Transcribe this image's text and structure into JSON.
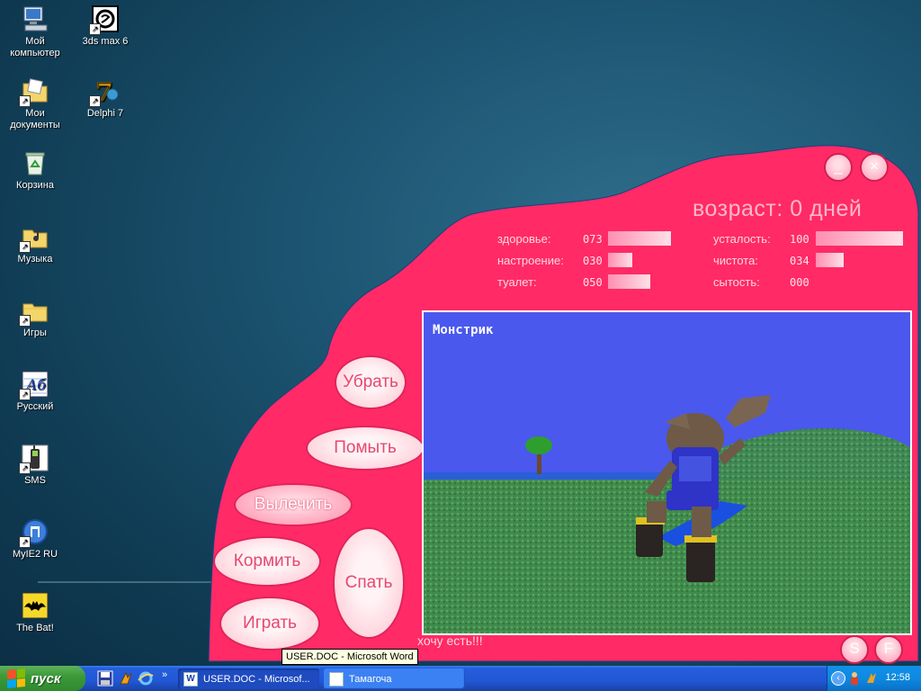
{
  "desktop": {
    "icons": [
      {
        "label": "Мой компьютер",
        "icon": "my-computer-icon"
      },
      {
        "label": "3ds max 6",
        "icon": "3dsmax-icon"
      },
      {
        "label": "Мои документы",
        "icon": "my-documents-icon"
      },
      {
        "label": "Delphi 7",
        "icon": "delphi-icon"
      },
      {
        "label": "Корзина",
        "icon": "recycle-bin-icon"
      },
      {
        "label": "Музыка",
        "icon": "music-folder-icon"
      },
      {
        "label": "Игры",
        "icon": "games-folder-icon"
      },
      {
        "label": "Русский",
        "icon": "russian-icon"
      },
      {
        "label": "SMS",
        "icon": "sms-icon"
      },
      {
        "label": "MyIE2 RU",
        "icon": "myie2-icon"
      },
      {
        "label": "The Bat!",
        "icon": "thebat-icon"
      }
    ]
  },
  "tamagotchi": {
    "age_text": "возраст: 0 дней",
    "controls": {
      "minimize": "_",
      "close": "×",
      "sound": "S",
      "fullscreen": "F"
    },
    "stats": [
      {
        "label": "здоровье:",
        "value": "073",
        "level": 0.73
      },
      {
        "label": "настроение:",
        "value": "030",
        "level": 0.3
      },
      {
        "label": "туалет:",
        "value": "050",
        "level": 0.5
      },
      {
        "label": "усталость:",
        "value": "100",
        "level": 1.0
      },
      {
        "label": "чистота:",
        "value": "034",
        "level": 0.34
      },
      {
        "label": "сытость:",
        "value": "000",
        "level": 0.0
      }
    ],
    "buttons": {
      "clean": "Убрать",
      "wash": "Помыть",
      "heal": "Вылечить",
      "feed": "Кормить",
      "sleep": "Спать",
      "play": "Играть"
    },
    "pet_name": "Монстрик",
    "status_message": "хочу есть!!!",
    "colors": {
      "body": "#ff2a66",
      "sky": "#4a58ee",
      "grass": "#3f8a4c"
    }
  },
  "taskbar": {
    "start_label": "пуск",
    "tasks": [
      {
        "label": "USER.DOC - Microsof...",
        "icon": "word-icon"
      },
      {
        "label": "Тамагоча",
        "icon": "window-icon"
      }
    ],
    "clock": "12:58",
    "tooltip": "USER.DOC - Microsoft Word"
  }
}
